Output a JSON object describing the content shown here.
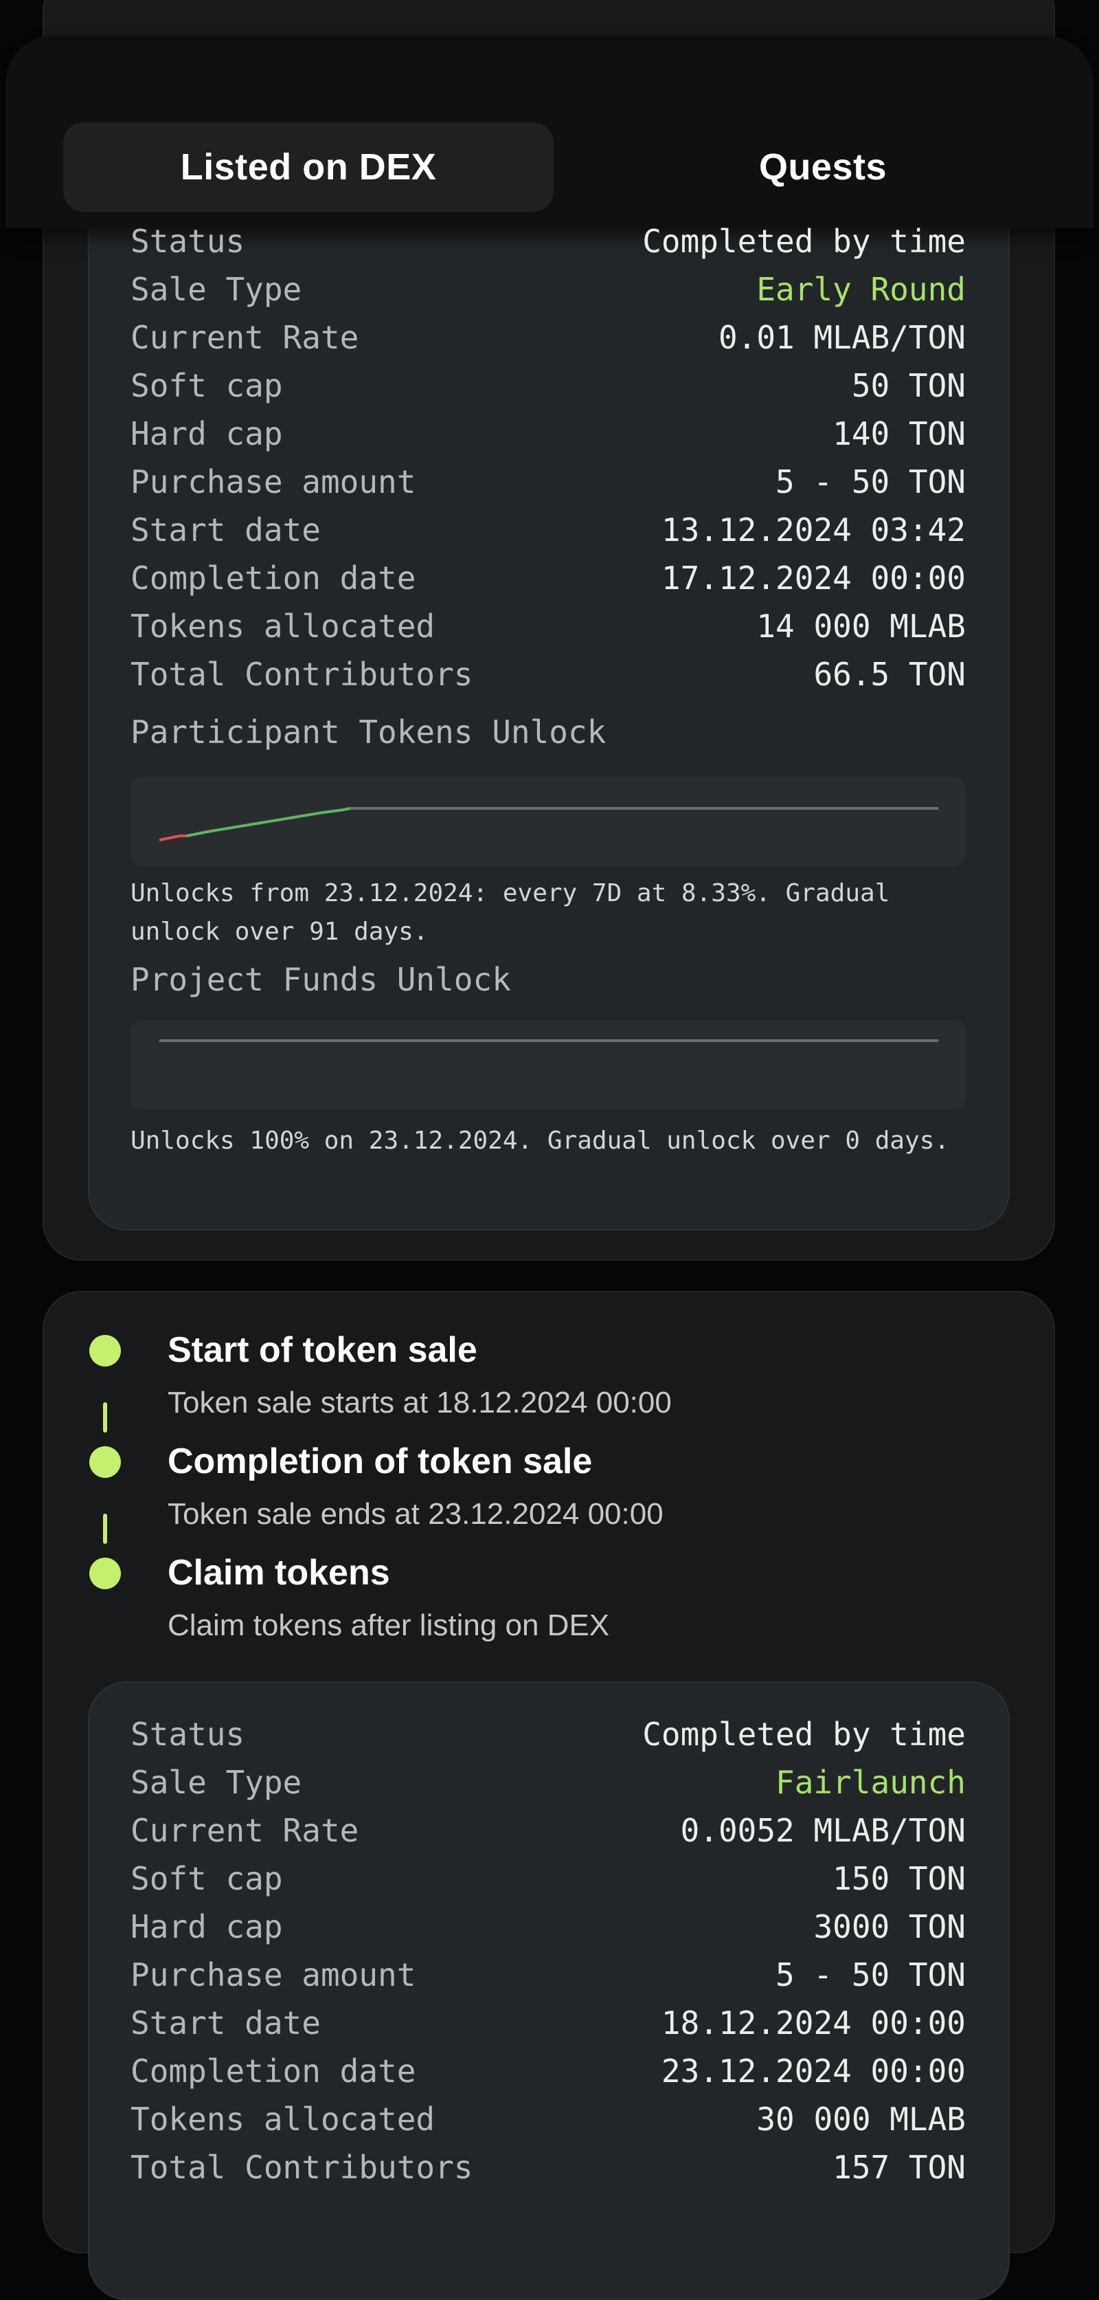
{
  "tabs": [
    {
      "label": "Listed on DEX",
      "active": true
    },
    {
      "label": "Quests",
      "active": false
    }
  ],
  "sale1": {
    "rows": [
      {
        "label": "Status",
        "value": "Completed by time"
      },
      {
        "label": "Sale Type",
        "value": "Early Round"
      },
      {
        "label": "Current Rate",
        "value": "0.01 MLAB/TON"
      },
      {
        "label": "Soft cap",
        "value": "50 TON"
      },
      {
        "label": "Hard cap",
        "value": "140 TON"
      },
      {
        "label": "Purchase amount",
        "value": "5 - 50 TON"
      },
      {
        "label": "Start date",
        "value": "13.12.2024 03:42"
      },
      {
        "label": "Completion date",
        "value": "17.12.2024 00:00"
      },
      {
        "label": "Tokens allocated",
        "value": "14 000 MLAB"
      },
      {
        "label": "Total Contributors",
        "value": "66.5 TON"
      }
    ],
    "participant_unlock_title": "Participant Tokens Unlock",
    "participant_unlock_note": "Unlocks from 23.12.2024: every 7D at 8.33%. Gradual unlock over 91 days.",
    "project_unlock_title": "Project Funds Unlock",
    "project_unlock_note": "Unlocks 100% on 23.12.2024. Gradual unlock over 0 days."
  },
  "timeline": [
    {
      "title": "Start of token sale",
      "desc": "Token sale starts at 18.12.2024 00:00"
    },
    {
      "title": "Completion of token sale",
      "desc": "Token sale ends at 23.12.2024 00:00"
    },
    {
      "title": "Claim tokens",
      "desc": "Claim tokens after listing on DEX"
    }
  ],
  "sale2": {
    "rows": [
      {
        "label": "Status",
        "value": "Completed by time"
      },
      {
        "label": "Sale Type",
        "value": "Fairlaunch"
      },
      {
        "label": "Current Rate",
        "value": "0.0052 MLAB/TON"
      },
      {
        "label": "Soft cap",
        "value": "150 TON"
      },
      {
        "label": "Hard cap",
        "value": "3000 TON"
      },
      {
        "label": "Purchase amount",
        "value": "5 - 50 TON"
      },
      {
        "label": "Start date",
        "value": "18.12.2024 00:00"
      },
      {
        "label": "Completion date",
        "value": "23.12.2024 00:00"
      },
      {
        "label": "Tokens allocated",
        "value": "30 000 MLAB"
      },
      {
        "label": "Total Contributors",
        "value": "157 TON"
      }
    ]
  },
  "colors": {
    "accent_green": "#c4f06c",
    "sale_type_green": "#a6e36a",
    "unlock_past": "#d9534f",
    "unlock_progress": "#5cb85c",
    "unlock_flat": "#6b6e70"
  }
}
